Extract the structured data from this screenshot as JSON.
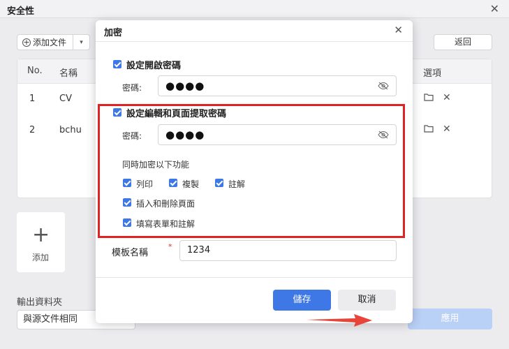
{
  "window": {
    "title": "安全性"
  },
  "toolbar": {
    "add_file_label": "添加文件",
    "return_label": "返回"
  },
  "table": {
    "headers": {
      "no": "No.",
      "name": "名稱",
      "options": "選項"
    },
    "rows": [
      {
        "no": "1",
        "name": "CV"
      },
      {
        "no": "2",
        "name": "bchu"
      }
    ]
  },
  "add_card": {
    "label": "添加"
  },
  "output": {
    "label": "輸出資料夾",
    "value": "與源文件相同"
  },
  "apply_label": "應用",
  "dialog": {
    "title": "加密",
    "open_password": {
      "label": "設定開啟密碼",
      "checked": true,
      "field_label": "密碼:",
      "value": "●●●●"
    },
    "edit_password": {
      "label": "設定編輯和頁面提取密碼",
      "checked": true,
      "field_label": "密碼:",
      "value": "●●●●"
    },
    "also_encrypt_label": "同時加密以下功能",
    "features": [
      {
        "label": "列印",
        "checked": true
      },
      {
        "label": "複製",
        "checked": true
      },
      {
        "label": "註解",
        "checked": true
      },
      {
        "label": "插入和刪除頁面",
        "checked": true
      },
      {
        "label": "填寫表單和註解",
        "checked": true
      }
    ],
    "template_name": {
      "label": "模板名稱",
      "required_mark": "*",
      "value": "1234"
    },
    "save_label": "儲存",
    "cancel_label": "取消"
  },
  "colors": {
    "accent": "#3d78e6",
    "highlight_box": "#dd2323",
    "apply_disabled": "#b9d0f7"
  }
}
